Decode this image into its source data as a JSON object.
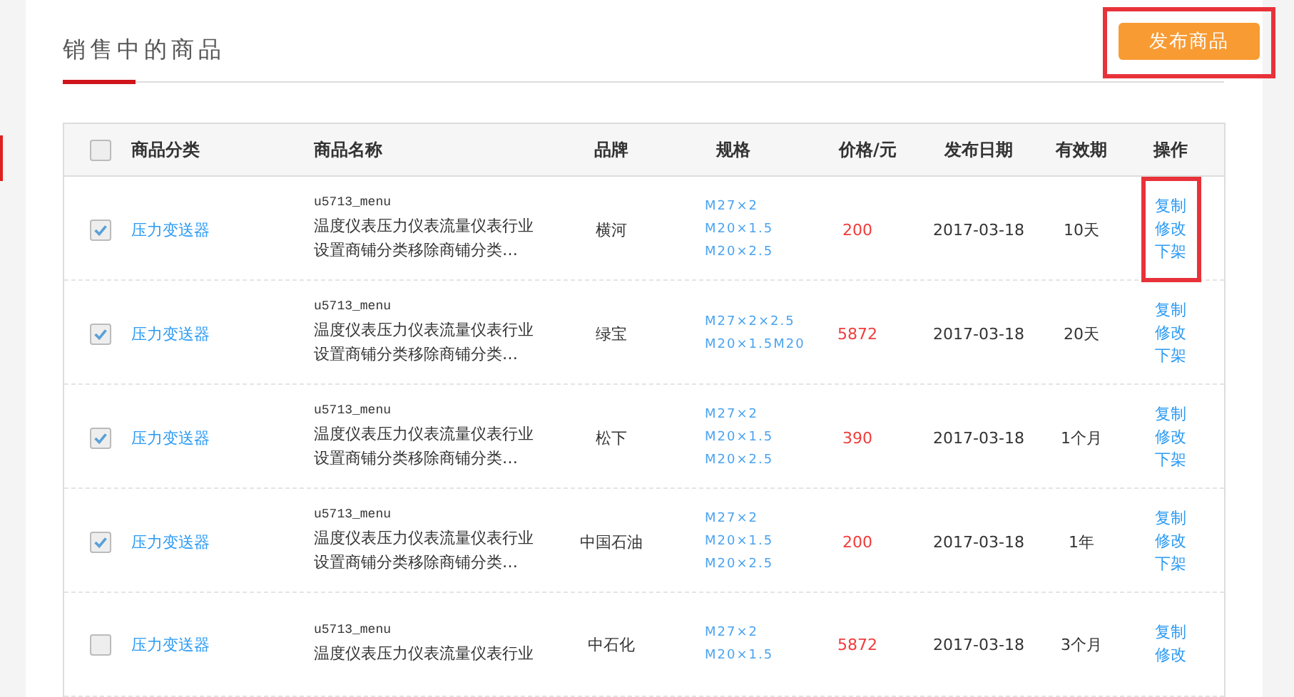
{
  "page_title": "销售中的商品",
  "publish_button": {
    "label": "发布商品",
    "highlighted": true
  },
  "table": {
    "select_all": {
      "checked": false
    },
    "columns": [
      "商品分类",
      "商品名称",
      "品牌",
      "规格",
      "价格/元",
      "发布日期",
      "有效期",
      "操作"
    ],
    "rows": [
      {
        "checked": true,
        "category": "压力变送器",
        "code": "u5713_menu",
        "name_lines": [
          "温度仪表压力仪表流量仪表行业",
          "设置商铺分类移除商铺分类…"
        ],
        "brand": "横河",
        "specs": [
          "M27×2",
          "M20×1.5",
          "M20×2.5"
        ],
        "price": "200",
        "date": "2017-03-18",
        "validity": "10天",
        "actions": [
          "复制",
          "修改",
          "下架"
        ],
        "actions_highlighted": true
      },
      {
        "checked": true,
        "category": "压力变送器",
        "code": "u5713_menu",
        "name_lines": [
          "温度仪表压力仪表流量仪表行业",
          "设置商铺分类移除商铺分类…"
        ],
        "brand": "绿宝",
        "specs": [
          "M27×2×2.5",
          "M20×1.5M20"
        ],
        "price": "5872",
        "date": "2017-03-18",
        "validity": "20天",
        "actions": [
          "复制",
          "修改",
          "下架"
        ],
        "actions_highlighted": false
      },
      {
        "checked": true,
        "category": "压力变送器",
        "code": "u5713_menu",
        "name_lines": [
          "温度仪表压力仪表流量仪表行业",
          "设置商铺分类移除商铺分类…"
        ],
        "brand": "松下",
        "specs": [
          "M27×2",
          "M20×1.5",
          "M20×2.5"
        ],
        "price": "390",
        "date": "2017-03-18",
        "validity": "1个月",
        "actions": [
          "复制",
          "修改",
          "下架"
        ],
        "actions_highlighted": false
      },
      {
        "checked": true,
        "category": "压力变送器",
        "code": "u5713_menu",
        "name_lines": [
          "温度仪表压力仪表流量仪表行业",
          "设置商铺分类移除商铺分类…"
        ],
        "brand": "中国石油",
        "specs": [
          "M27×2",
          "M20×1.5",
          "M20×2.5"
        ],
        "price": "200",
        "date": "2017-03-18",
        "validity": "1年",
        "actions": [
          "复制",
          "修改",
          "下架"
        ],
        "actions_highlighted": false
      },
      {
        "checked": false,
        "category": "压力变送器",
        "code": "u5713_menu",
        "name_lines": [
          "温度仪表压力仪表流量仪表行业"
        ],
        "brand": "中石化",
        "specs": [
          "M27×2",
          "M20×1.5"
        ],
        "price": "5872",
        "date": "2017-03-18",
        "validity": "3个月",
        "actions": [
          "复制",
          "修改"
        ],
        "actions_highlighted": false
      }
    ]
  }
}
